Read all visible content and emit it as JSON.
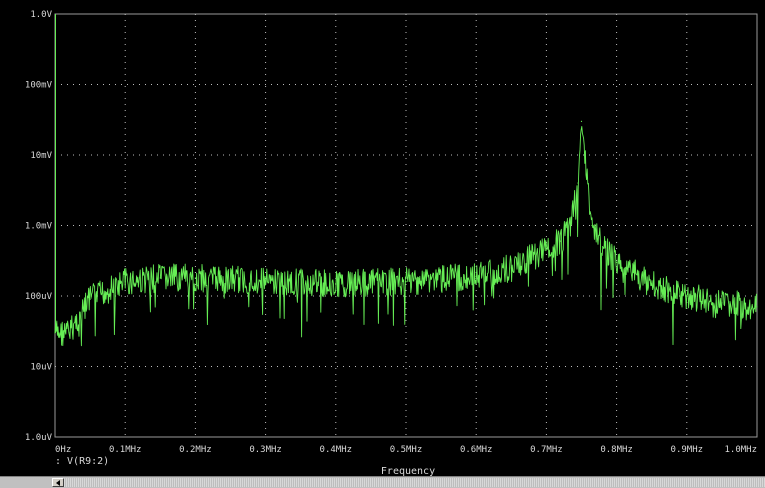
{
  "chart_data": {
    "type": "line",
    "xlabel": "Frequency",
    "x_ticks": [
      "0Hz",
      "0.1MHz",
      "0.2MHz",
      "0.3MHz",
      "0.4MHz",
      "0.5MHz",
      "0.6MHz",
      "0.7MHz",
      "0.8MHz",
      "0.9MHz",
      "1.0MHz"
    ],
    "y_ticks": [
      "1.0V",
      "100mV",
      "10mV",
      "1.0mV",
      "100uV",
      "10uV",
      "1.0uV"
    ],
    "y_scale": "log",
    "xlim": [
      0,
      1000000
    ],
    "ylim": [
      1e-06,
      1
    ],
    "grid": true,
    "legend": ": V(R9:2)",
    "series": [
      {
        "name": "V(R9:2)",
        "color": "#66ee55",
        "x": [
          0,
          20000,
          50000,
          100000,
          150000,
          200000,
          300000,
          400000,
          500000,
          600000,
          650000,
          700000,
          720000,
          735000,
          745000,
          750000,
          755000,
          765000,
          780000,
          800000,
          850000,
          900000,
          950000,
          1000000
        ],
        "y": [
          3e-05,
          3e-05,
          9e-05,
          0.00016,
          0.00018,
          0.00018,
          0.00016,
          0.00015,
          0.00016,
          0.00019,
          0.00025,
          0.00045,
          0.0006,
          0.001,
          0.004,
          0.03,
          0.01,
          0.001,
          0.0005,
          0.0003,
          0.00015,
          0.0001,
          8e-05,
          7e-05
        ]
      }
    ]
  }
}
